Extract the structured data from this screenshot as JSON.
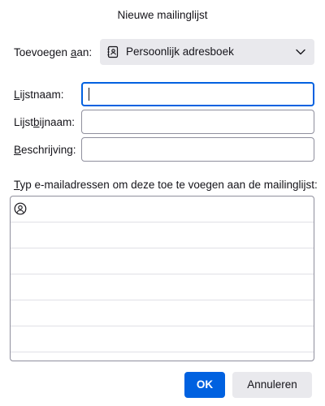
{
  "dialog": {
    "title": "Nieuwe mailinglijst"
  },
  "add_to": {
    "label": "Toevoegen aan:",
    "selected": "Persoonlijk adresboek",
    "icon": "address-book-icon"
  },
  "fields": {
    "list_name": {
      "label": "Lijstnaam:",
      "value": ""
    },
    "list_nickname": {
      "label": "Lijstbijnaam:",
      "value": ""
    },
    "description": {
      "label": "Beschrijving:",
      "value": ""
    }
  },
  "addresses": {
    "label": "Typ e-mailadressen om deze toe te voegen aan de mailinglijst:",
    "rows": [
      "",
      "",
      "",
      "",
      "",
      ""
    ]
  },
  "buttons": {
    "ok": "OK",
    "cancel": "Annuleren"
  },
  "colors": {
    "accent": "#0061e0",
    "button_gray": "#e9e9ed",
    "border": "#8f8f9d"
  }
}
